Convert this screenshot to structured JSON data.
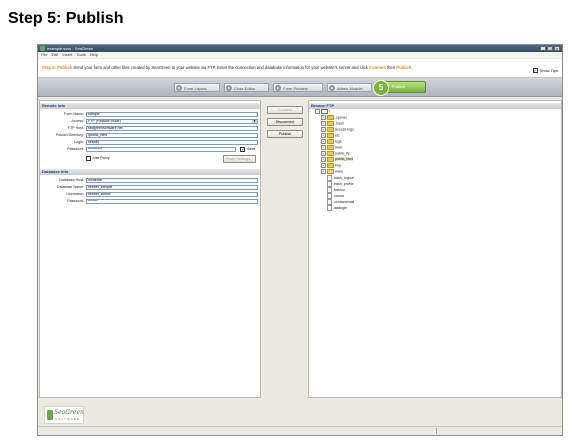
{
  "page_heading": "Step 5: Publish",
  "app": {
    "title": "example.sxcs - SeaGreen",
    "window_buttons": [
      "_",
      "□",
      "x"
    ]
  },
  "menu": [
    "File",
    "Edit",
    "Insert",
    "Tools",
    "Help"
  ],
  "tips": {
    "step_label": "Step 5: Publish",
    "text_before": " Send your form and other files created by SeaGreen to your website via FTP.  Enter the connection and database information for your website's server and click ",
    "connect_word": "Connect",
    "text_middle": " then ",
    "publish_word": "Publish",
    "text_after": ".",
    "show_tips_label": "Show Tips",
    "show_tips_checked": true
  },
  "steps": [
    {
      "label": "Form Layout"
    },
    {
      "label": "Code Editor"
    },
    {
      "label": "Form Preview"
    },
    {
      "label": "Admin Module"
    }
  ],
  "current_step": {
    "number": "5",
    "label": "Publish"
  },
  "remote_info": {
    "title": "Remote Info",
    "form_name_label": "Form Name:",
    "form_name": "sample",
    "access_label": "Access:",
    "access": "FTP (Passive Mode)",
    "ftp_host_label": "FTP Host:",
    "ftp_host": "seagreensoftware.net",
    "publish_dir_label": "Publish Directory:",
    "publish_dir": "/public_html",
    "login_label": "Login:",
    "login": "seanet",
    "password_label": "Password:",
    "password": "**********",
    "save_label": "Save",
    "save_checked": true,
    "use_proxy_label": "Use Proxy",
    "use_proxy_checked": false,
    "proxy_settings_label": "Proxy Settings..."
  },
  "database_info": {
    "title": "Database Info",
    "host_label": "Database Host:",
    "host": "localhost",
    "name_label": "Database Name:",
    "name": "seanet_sample",
    "username_label": "Username:",
    "username": "seanet_admin",
    "password_label": "Password:",
    "password": "*******"
  },
  "actions": {
    "connect": "Connect",
    "disconnect": "Disconnect",
    "publish": "Publish"
  },
  "browse_ftp": {
    "title": "Browse FTP",
    "root": "/",
    "folders": [
      ".cpanel",
      ".trash",
      "access-logs",
      "etc",
      "logs",
      "mail",
      "public_ftp",
      "public_html",
      "tmp",
      "www"
    ],
    "selected_folder": "public_html",
    "files": [
      ".bash_logout",
      ".bash_profile",
      ".bashrc",
      ".canna",
      ".contactemail",
      ".lastlogin"
    ]
  },
  "logo": {
    "name": "SeaGreen",
    "subtitle": "SOFTWARE"
  }
}
